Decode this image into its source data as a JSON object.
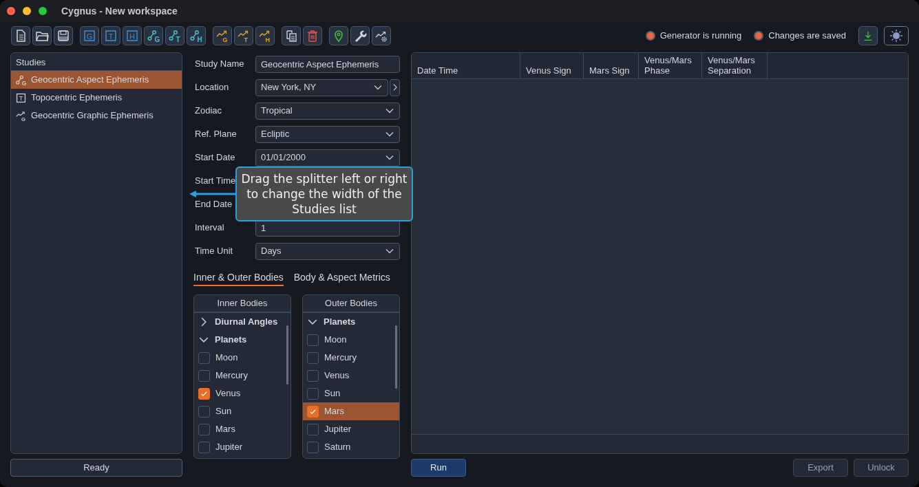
{
  "window": {
    "title": "Cygnus - New workspace"
  },
  "toolbar": [
    {
      "kind": "document"
    },
    {
      "kind": "folder"
    },
    {
      "kind": "save"
    },
    {
      "kind": "gap"
    },
    {
      "kind": "box",
      "letter": "G"
    },
    {
      "kind": "box",
      "letter": "T"
    },
    {
      "kind": "box",
      "letter": "H"
    },
    {
      "kind": "aspect",
      "letter": "G"
    },
    {
      "kind": "aspect",
      "letter": "T"
    },
    {
      "kind": "aspect",
      "letter": "H"
    },
    {
      "kind": "gap"
    },
    {
      "kind": "graph",
      "letter": "G"
    },
    {
      "kind": "graph",
      "letter": "T"
    },
    {
      "kind": "graph",
      "letter": "H"
    },
    {
      "kind": "gap"
    },
    {
      "kind": "copy"
    },
    {
      "kind": "trash"
    },
    {
      "kind": "gap"
    },
    {
      "kind": "pin"
    },
    {
      "kind": "wrench"
    },
    {
      "kind": "graph-gear"
    }
  ],
  "indicators": [
    {
      "label": "Generator is running",
      "on": true
    },
    {
      "label": "Changes are saved",
      "on": true
    }
  ],
  "toolbar_right": [
    {
      "kind": "download"
    },
    {
      "kind": "theme"
    }
  ],
  "studies": {
    "title": "Studies",
    "items": [
      {
        "kind": "aspect",
        "letter": "G",
        "label": "Geocentric Aspect Ephemeris",
        "selected": true
      },
      {
        "kind": "box",
        "letter": "T",
        "label": "Topocentric Ephemeris",
        "selected": false
      },
      {
        "kind": "graph",
        "letter": "G",
        "label": "Geocentric Graphic Ephemeris",
        "selected": false
      }
    ]
  },
  "status_button": "Ready",
  "form": [
    {
      "label": "Study Name",
      "kind": "text",
      "value": "Geocentric Aspect Ephemeris"
    },
    {
      "label": "Location",
      "kind": "select",
      "value": "New York, NY",
      "next": true
    },
    {
      "label": "Zodiac",
      "kind": "select",
      "value": "Tropical"
    },
    {
      "label": "Ref. Plane",
      "kind": "select",
      "value": "Ecliptic"
    },
    {
      "label": "Start Date",
      "kind": "select",
      "value": "01/01/2000"
    },
    {
      "label": "Start Time",
      "kind": "covered"
    },
    {
      "label": "End Date",
      "kind": "covered"
    },
    {
      "label": "Interval",
      "kind": "text",
      "value": "1"
    },
    {
      "label": "Time Unit",
      "kind": "select",
      "value": "Days"
    }
  ],
  "tabs": [
    {
      "label": "Inner & Outer Bodies",
      "selected": true
    },
    {
      "label": "Body & Aspect Metrics",
      "selected": false
    }
  ],
  "lists": [
    {
      "title": "Inner Bodies",
      "items": [
        {
          "label": "Diurnal Angles",
          "expanded": false,
          "selected": false
        },
        {
          "label": "Planets",
          "expanded": true,
          "selected": false,
          "children": [
            {
              "label": "Moon",
              "checked": false,
              "selected": false
            },
            {
              "label": "Mercury",
              "checked": false,
              "selected": false
            },
            {
              "label": "Venus",
              "checked": true,
              "selected": false
            },
            {
              "label": "Sun",
              "checked": false,
              "selected": false
            },
            {
              "label": "Mars",
              "checked": false,
              "selected": false
            },
            {
              "label": "Jupiter",
              "checked": false,
              "selected": false
            }
          ]
        }
      ]
    },
    {
      "title": "Outer Bodies",
      "items": [
        {
          "label": "Planets",
          "expanded": true,
          "selected": false,
          "children": [
            {
              "label": "Moon",
              "checked": false,
              "selected": false
            },
            {
              "label": "Mercury",
              "checked": false,
              "selected": false
            },
            {
              "label": "Venus",
              "checked": false,
              "selected": false
            },
            {
              "label": "Sun",
              "checked": false,
              "selected": false
            },
            {
              "label": "Mars",
              "checked": true,
              "selected": true
            },
            {
              "label": "Jupiter",
              "checked": false,
              "selected": false
            },
            {
              "label": "Saturn",
              "checked": false,
              "selected": false
            }
          ]
        }
      ]
    }
  ],
  "table": {
    "columns": [
      "Date Time",
      "Venus Sign",
      "Mars Sign",
      "Venus/Mars Phase",
      "Venus/Mars Separation"
    ]
  },
  "buttons": [
    {
      "label": "Run",
      "kind": "primary"
    },
    {
      "label": "Export",
      "kind": "secondary"
    },
    {
      "label": "Unlock",
      "kind": "secondary"
    }
  ],
  "tooltip": {
    "text": "Drag the splitter left or right to change the width of the Studies list"
  }
}
